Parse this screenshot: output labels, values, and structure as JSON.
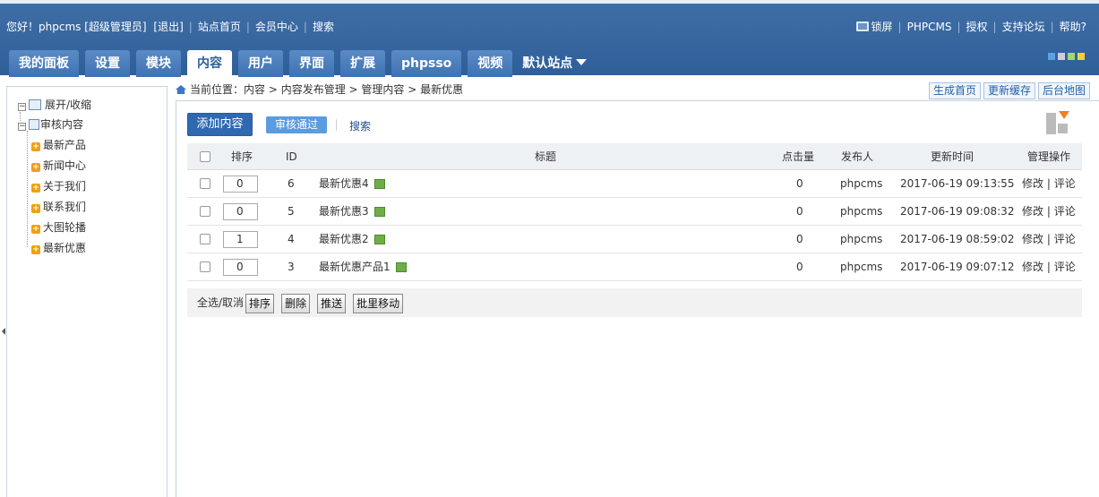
{
  "topbar": {
    "greeting": "您好！phpcms [超级管理员]",
    "logout": "[退出]",
    "links": [
      "站点首页",
      "会员中心",
      "搜索"
    ],
    "lock": "锁屏",
    "brand": "PHPCMS",
    "right_links": [
      "授权",
      "支持论坛",
      "帮助?"
    ]
  },
  "nav": {
    "tabs": [
      "我的面板",
      "设置",
      "模块",
      "内容",
      "用户",
      "界面",
      "扩展",
      "phpsso",
      "视频"
    ],
    "active": "内容",
    "site_select": "默认站点"
  },
  "skins": {
    "colors": [
      "#5fa0e0",
      "#cfcfcf",
      "#a0d870",
      "#f0d040"
    ]
  },
  "sidebar": {
    "toggle_label": "展开/收缩",
    "root": "审核内容",
    "items": [
      "最新产品",
      "新闻中心",
      "关于我们",
      "联系我们",
      "大图轮播",
      "最新优惠"
    ]
  },
  "breadcrumb": {
    "label": "当前位置：",
    "path": "内容 > 内容发布管理 > 管理内容 > 最新优惠",
    "buttons": [
      "生成首页",
      "更新缓存",
      "后台地图"
    ]
  },
  "actions": {
    "add": "添加内容",
    "audit": "审核通过",
    "search": "搜索"
  },
  "table": {
    "headers": {
      "order": "排序",
      "id": "ID",
      "title": "标题",
      "hits": "点击量",
      "author": "发布人",
      "time": "更新时间",
      "ops": "管理操作"
    },
    "rows": [
      {
        "order": "0",
        "id": "6",
        "title": "最新优惠4",
        "hits": "0",
        "author": "phpcms",
        "time": "2017-06-19 09:13:55",
        "edit": "修改",
        "comment": "评论"
      },
      {
        "order": "0",
        "id": "5",
        "title": "最新优惠3",
        "hits": "0",
        "author": "phpcms",
        "time": "2017-06-19 09:08:32",
        "edit": "修改",
        "comment": "评论"
      },
      {
        "order": "1",
        "id": "4",
        "title": "最新优惠2",
        "hits": "0",
        "author": "phpcms",
        "time": "2017-06-19 08:59:02",
        "edit": "修改",
        "comment": "评论"
      },
      {
        "order": "0",
        "id": "3",
        "title": "最新优惠产品1",
        "hits": "0",
        "author": "phpcms",
        "time": "2017-06-19 09:07:12",
        "edit": "修改",
        "comment": "评论"
      }
    ]
  },
  "footer": {
    "select_all": "全选/取消",
    "buttons": [
      "排序",
      "删除",
      "推送",
      "批里移动"
    ]
  }
}
